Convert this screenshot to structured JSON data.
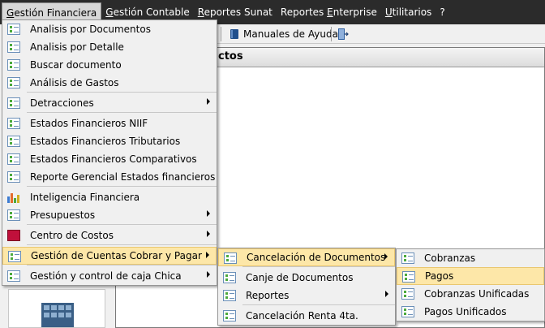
{
  "menubar": {
    "items": [
      {
        "label": "Gestión Financiera",
        "underline": "G",
        "rest": "estión Financiera"
      },
      {
        "label": "Gestión Contable",
        "underline": "G",
        "rest": "estión Contable"
      },
      {
        "label": "Reportes Sunat",
        "underline": "R",
        "rest": "eportes Sunat"
      },
      {
        "label": "Reportes Enterprise",
        "pre": "Reportes ",
        "underline": "E",
        "rest": "nterprise"
      },
      {
        "label": "Utilitarios",
        "underline": "U",
        "rest": "tilitarios"
      },
      {
        "label": "?"
      }
    ]
  },
  "toolbar": {
    "help_label": "Manuales de Ayuda"
  },
  "panel": {
    "title_fragment": "ctos"
  },
  "menu_main": {
    "items": [
      {
        "label": "Analisis por Documentos",
        "icon": "document-list-icon"
      },
      {
        "label": "Analisis por Detalle",
        "icon": "document-list-icon"
      },
      {
        "label": "Buscar documento",
        "icon": "document-list-icon"
      },
      {
        "label": "Análisis de Gastos",
        "icon": "document-list-icon"
      },
      {
        "label": "Detracciones",
        "icon": "document-list-icon",
        "submenu": true
      },
      {
        "label": "Estados Financieros NIIF",
        "icon": "document-list-icon"
      },
      {
        "label": "Estados Financieros Tributarios",
        "icon": "document-list-icon"
      },
      {
        "label": "Estados Financieros Comparativos",
        "icon": "document-list-icon"
      },
      {
        "label": "Reporte Gerencial Estados financieros",
        "icon": "document-list-icon"
      },
      {
        "label": "Inteligencia Financiera",
        "icon": "bar-chart-icon"
      },
      {
        "label": "Presupuestos",
        "icon": "document-list-icon",
        "submenu": true
      },
      {
        "label": "Centro de Costos",
        "icon": "cost-center-icon",
        "submenu": true
      },
      {
        "label": "Gestión de Cuentas Cobrar y Pagar",
        "icon": "document-list-icon",
        "submenu": true
      },
      {
        "label": "Gestión y control de caja Chica",
        "icon": "document-list-icon",
        "submenu": true
      }
    ]
  },
  "menu_cuentas": {
    "items": [
      {
        "label": "Cancelación de Documentos",
        "submenu": true
      },
      {
        "label": "Canje de Documentos"
      },
      {
        "label": "Reportes",
        "submenu": true
      },
      {
        "label": "Cancelación Renta 4ta."
      }
    ]
  },
  "menu_cancelacion": {
    "items": [
      {
        "label": "Cobranzas"
      },
      {
        "label": "Pagos"
      },
      {
        "label": "Cobranzas Unificadas"
      },
      {
        "label": "Pagos Unificados"
      }
    ]
  },
  "colors": {
    "menubar_bg": "#2b2b2b",
    "highlight_bg": "#fde7a8",
    "highlight_border": "#e9c770"
  }
}
